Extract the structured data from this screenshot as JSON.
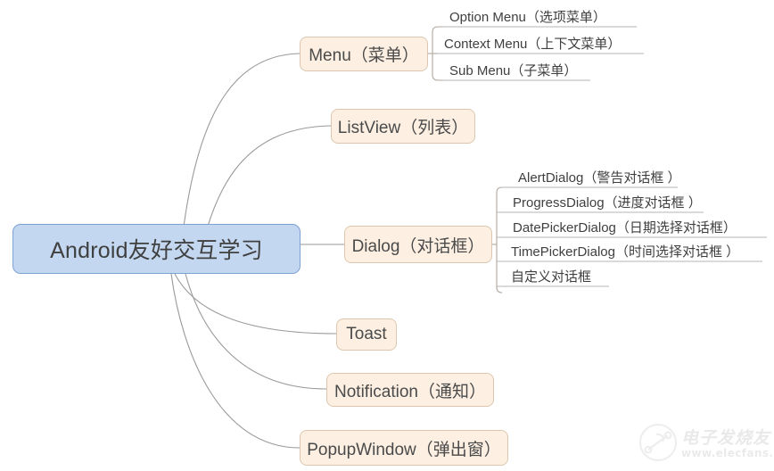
{
  "diagram": {
    "type": "mindmap",
    "root": {
      "label": "Android友好交互学习",
      "fill": "#c3d7f0",
      "stroke": "#7da2d1"
    },
    "branch_style": {
      "fill": "#fdf0e3",
      "stroke": "#dcc7ae"
    },
    "link_color": "#9a9a9a",
    "branches": [
      {
        "label": "Menu（菜单）",
        "children": [
          {
            "label": "Option Menu（选项菜单）"
          },
          {
            "label": "Context Menu（上下文菜单）"
          },
          {
            "label": "Sub Menu（子菜单）"
          }
        ]
      },
      {
        "label": "ListView（列表）",
        "children": []
      },
      {
        "label": "Dialog（对话框）",
        "children": [
          {
            "label": "AlertDialog（警告对话框 ）"
          },
          {
            "label": "ProgressDialog（进度对话框 ）"
          },
          {
            "label": "DatePickerDialog（日期选择对话框）"
          },
          {
            "label": "TimePickerDialog（时间选择对话框 ）"
          },
          {
            "label": "自定义对话框"
          }
        ]
      },
      {
        "label": "Toast",
        "children": []
      },
      {
        "label": "Notification（通知）",
        "children": []
      },
      {
        "label": "PopupWindow（弹出窗）",
        "children": []
      }
    ]
  },
  "watermark": {
    "brand": "电子发烧友",
    "url": "www.elecfans.com"
  }
}
